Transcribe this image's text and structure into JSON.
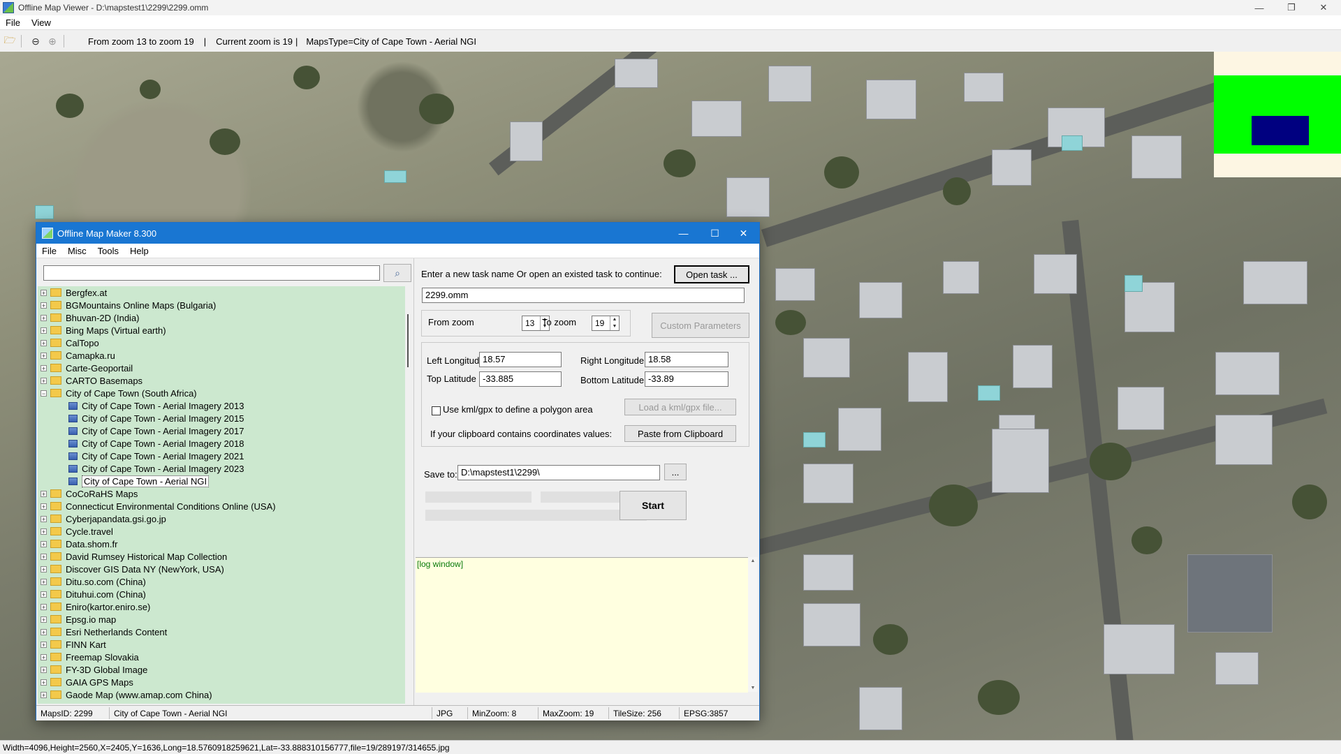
{
  "viewer": {
    "title": "Offline Map Viewer - D:\\mapstest1\\2299\\2299.omm",
    "menu": [
      "File",
      "View"
    ],
    "toolbar_info": {
      "zoom_range": "From zoom 13 to zoom 19",
      "current_zoom": "Current zoom is 19",
      "maps_type": "MapsType=City of Cape Town - Aerial NGI"
    },
    "status": "Width=4096,Height=2560,X=2405,Y=1636,Long=18.5760918259621,Lat=-33.888310156777,file=19/289197/314655.jpg",
    "minimap_colors": {
      "frame": "#00ff00",
      "viewport": "#000080"
    }
  },
  "maker": {
    "title": "Offline Map Maker 8.300",
    "menu": [
      "File",
      "Misc",
      "Tools",
      "Help"
    ],
    "search": {
      "value": "",
      "icon": "search-icon"
    },
    "tree": [
      {
        "label": "Bergfex.at",
        "type": "folder",
        "expanded": false
      },
      {
        "label": "BGMountains Online Maps (Bulgaria)",
        "type": "folder",
        "expanded": false
      },
      {
        "label": "Bhuvan-2D (India)",
        "type": "folder",
        "expanded": false
      },
      {
        "label": "Bing Maps (Virtual earth)",
        "type": "folder",
        "expanded": false
      },
      {
        "label": "CalTopo",
        "type": "folder",
        "expanded": false
      },
      {
        "label": "Camapka.ru",
        "type": "folder",
        "expanded": false
      },
      {
        "label": "Carte-Geoportail",
        "type": "folder",
        "expanded": false
      },
      {
        "label": "CARTO Basemaps",
        "type": "folder",
        "expanded": false
      },
      {
        "label": "City of Cape Town (South Africa)",
        "type": "folder",
        "expanded": true
      },
      {
        "label": "City of Cape Town - Aerial Imagery 2013",
        "type": "map"
      },
      {
        "label": "City of Cape Town - Aerial Imagery 2015",
        "type": "map"
      },
      {
        "label": "City of Cape Town - Aerial Imagery 2017",
        "type": "map"
      },
      {
        "label": "City of Cape Town - Aerial Imagery 2018",
        "type": "map"
      },
      {
        "label": "City of Cape Town - Aerial Imagery 2021",
        "type": "map"
      },
      {
        "label": "City of Cape Town - Aerial Imagery 2023",
        "type": "map"
      },
      {
        "label": "City of Cape Town - Aerial NGI",
        "type": "map",
        "selected": true
      },
      {
        "label": "CoCoRaHS Maps",
        "type": "folder",
        "expanded": false
      },
      {
        "label": "Connecticut Environmental Conditions Online (USA)",
        "type": "folder",
        "expanded": false
      },
      {
        "label": "Cyberjapandata.gsi.go.jp",
        "type": "folder",
        "expanded": false
      },
      {
        "label": "Cycle.travel",
        "type": "folder",
        "expanded": false
      },
      {
        "label": "Data.shom.fr",
        "type": "folder",
        "expanded": false
      },
      {
        "label": "David Rumsey Historical Map Collection",
        "type": "folder",
        "expanded": false
      },
      {
        "label": "Discover GIS Data NY (NewYork, USA)",
        "type": "folder",
        "expanded": false
      },
      {
        "label": "Ditu.so.com (China)",
        "type": "folder",
        "expanded": false
      },
      {
        "label": "Dituhui.com (China)",
        "type": "folder",
        "expanded": false
      },
      {
        "label": "Eniro(kartor.eniro.se)",
        "type": "folder",
        "expanded": false
      },
      {
        "label": "Epsg.io map",
        "type": "folder",
        "expanded": false
      },
      {
        "label": "Esri Netherlands Content",
        "type": "folder",
        "expanded": false
      },
      {
        "label": "FINN Kart",
        "type": "folder",
        "expanded": false
      },
      {
        "label": "Freemap Slovakia",
        "type": "folder",
        "expanded": false
      },
      {
        "label": "FY-3D Global Image",
        "type": "folder",
        "expanded": false
      },
      {
        "label": "GAIA GPS Maps",
        "type": "folder",
        "expanded": false
      },
      {
        "label": "Gaode Map (www.amap.com China)",
        "type": "folder",
        "expanded": false
      }
    ],
    "task": {
      "prompt": "Enter a new task name Or open an existed task to continue:",
      "open_button": "Open task ...",
      "name_value": "2299.omm"
    },
    "zoom": {
      "from_label": "From zoom",
      "from_value": "13",
      "to_label": "To zoom",
      "to_value": "19",
      "custom_button": "Custom Parameters"
    },
    "coords": {
      "left_label": "Left Longitude",
      "left_value": "18.57",
      "right_label": "Right Longitude",
      "right_value": "18.58",
      "top_label": "Top Latitude",
      "top_value": "-33.885",
      "bottom_label": "Bottom Latitude",
      "bottom_value": "-33.89",
      "kml_check_label": "Use kml/gpx to define a polygon area",
      "kml_checked": false,
      "kml_button": "Load a kml/gpx file...",
      "clipboard_label": "If your clipboard contains coordinates values:",
      "clipboard_button": "Paste from Clipboard"
    },
    "save": {
      "label": "Save to:",
      "path": "D:\\mapstest1\\2299\\",
      "browse": "..."
    },
    "start_button": "Start",
    "log": "[log window]",
    "status": {
      "maps_id": "MapsID: 2299",
      "map_name": "City of Cape Town - Aerial NGI",
      "format": "JPG",
      "min_zoom": "MinZoom: 8",
      "max_zoom": "MaxZoom: 19",
      "tile_size": "TileSize: 256",
      "epsg": "EPSG:3857"
    }
  }
}
